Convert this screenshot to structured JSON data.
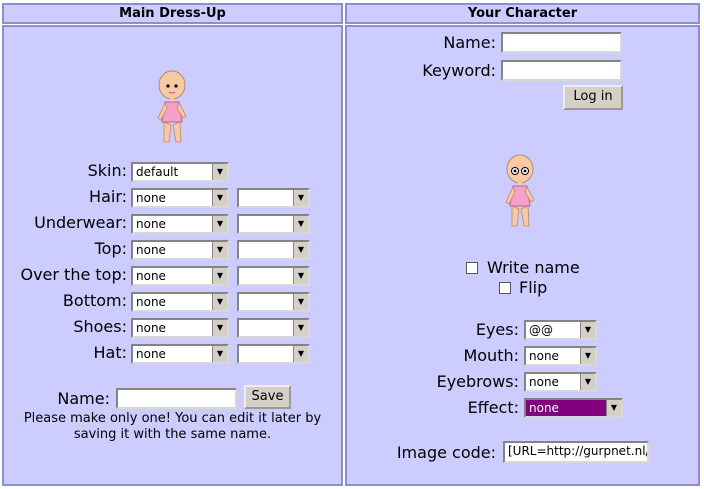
{
  "left": {
    "title": "Main Dress-Up",
    "rows": [
      {
        "label": "Skin:",
        "value": "default",
        "value2": null
      },
      {
        "label": "Hair:",
        "value": "none",
        "value2": ""
      },
      {
        "label": "Underwear:",
        "value": "none",
        "value2": ""
      },
      {
        "label": "Top:",
        "value": "none",
        "value2": ""
      },
      {
        "label": "Over the top:",
        "value": "none",
        "value2": ""
      },
      {
        "label": "Bottom:",
        "value": "none",
        "value2": ""
      },
      {
        "label": "Shoes:",
        "value": "none",
        "value2": ""
      },
      {
        "label": "Hat:",
        "value": "none",
        "value2": ""
      }
    ],
    "name_label": "Name:",
    "name_value": "",
    "save_label": "Save",
    "note": "Please make only one! You can edit it later by saving it with the same name."
  },
  "right": {
    "title": "Your Character",
    "name_label": "Name:",
    "keyword_label": "Keyword:",
    "login_label": "Log in",
    "write_name_label": "Write name",
    "flip_label": "Flip",
    "eyes_label": "Eyes:",
    "eyes_value": "@@",
    "mouth_label": "Mouth:",
    "mouth_value": "none",
    "eyebrows_label": "Eyebrows:",
    "eyebrows_value": "none",
    "effect_label": "Effect:",
    "effect_value": "none",
    "image_code_label": "Image code:",
    "image_code_value": "[URL=http://gurpnet.nl/su"
  },
  "colors": {
    "panel_bg": "#ccccff",
    "panel_border": "#8e8ecc",
    "effect_bg": "#800080",
    "skin": "#f7c9a5",
    "body_pink": "#f5a0c8"
  }
}
